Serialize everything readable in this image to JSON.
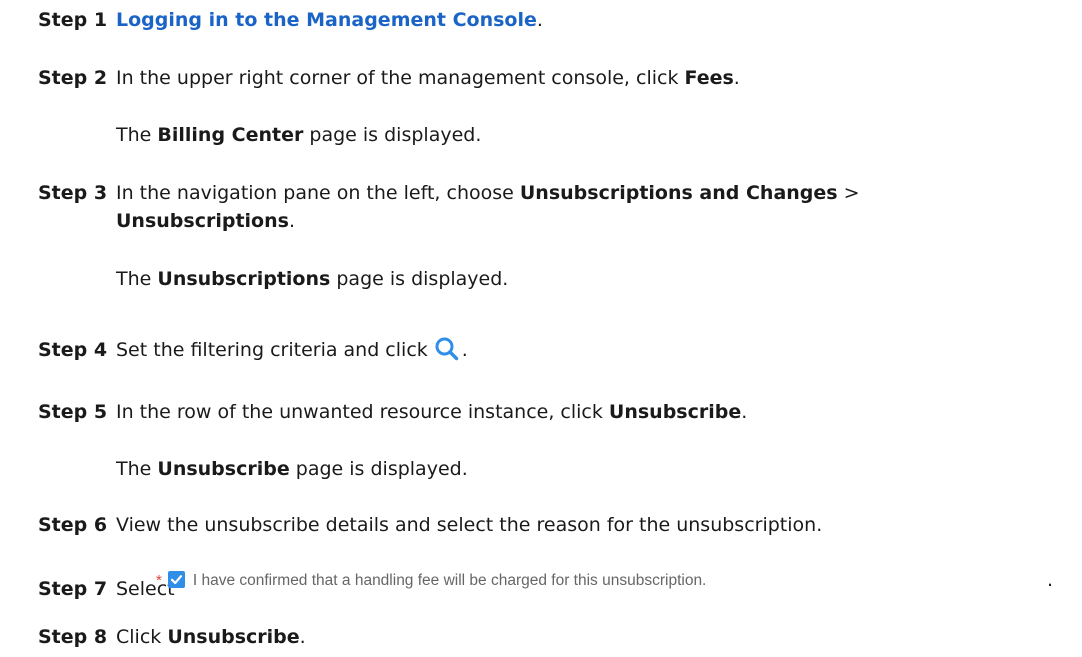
{
  "steps": [
    {
      "label": "Step 1",
      "link": "Logging in to the Management Console",
      "after": "."
    },
    {
      "label": "Step 2",
      "pre": "In the upper right corner of the management console, click ",
      "bold": "Fees",
      "after": "."
    },
    {
      "label": "Step 3",
      "pre": "In the navigation pane on the left, choose ",
      "bold1": "Unsubscriptions and Changes",
      "mid": " >",
      "bold2": "Unsubscriptions",
      "after": "."
    },
    {
      "label": "Step 4",
      "pre": "Set the filtering criteria and click",
      "after": "."
    },
    {
      "label": "Step 5",
      "pre": "In the row of the unwanted resource instance, click ",
      "bold": "Unsubscribe",
      "after": "."
    },
    {
      "label": "Step 6",
      "pre": "View the unsubscribe details and select the reason for the unsubscription."
    },
    {
      "label": "Step 7",
      "pre": "Select"
    },
    {
      "label": "Step 8",
      "pre": "Click ",
      "bold": "Unsubscribe",
      "after": "."
    }
  ],
  "results": [
    {
      "pre": "The ",
      "bold": "Billing Center",
      "after": " page is displayed."
    },
    {
      "pre": "The ",
      "bold": "Unsubscriptions",
      "after": " page is displayed."
    },
    {
      "pre": "The ",
      "bold": "Unsubscribe",
      "after": " page is displayed."
    }
  ],
  "confirm": {
    "star": "*",
    "text": "I have confirmed that a handling fee will be charged for this unsubscription.",
    "after": "."
  },
  "colors": {
    "link": "#1a64c8",
    "icon": "#2f8ee8",
    "required": "#e2463a"
  },
  "icons": {
    "search": "search-icon",
    "checkbox": "checkbox-checked-icon"
  }
}
